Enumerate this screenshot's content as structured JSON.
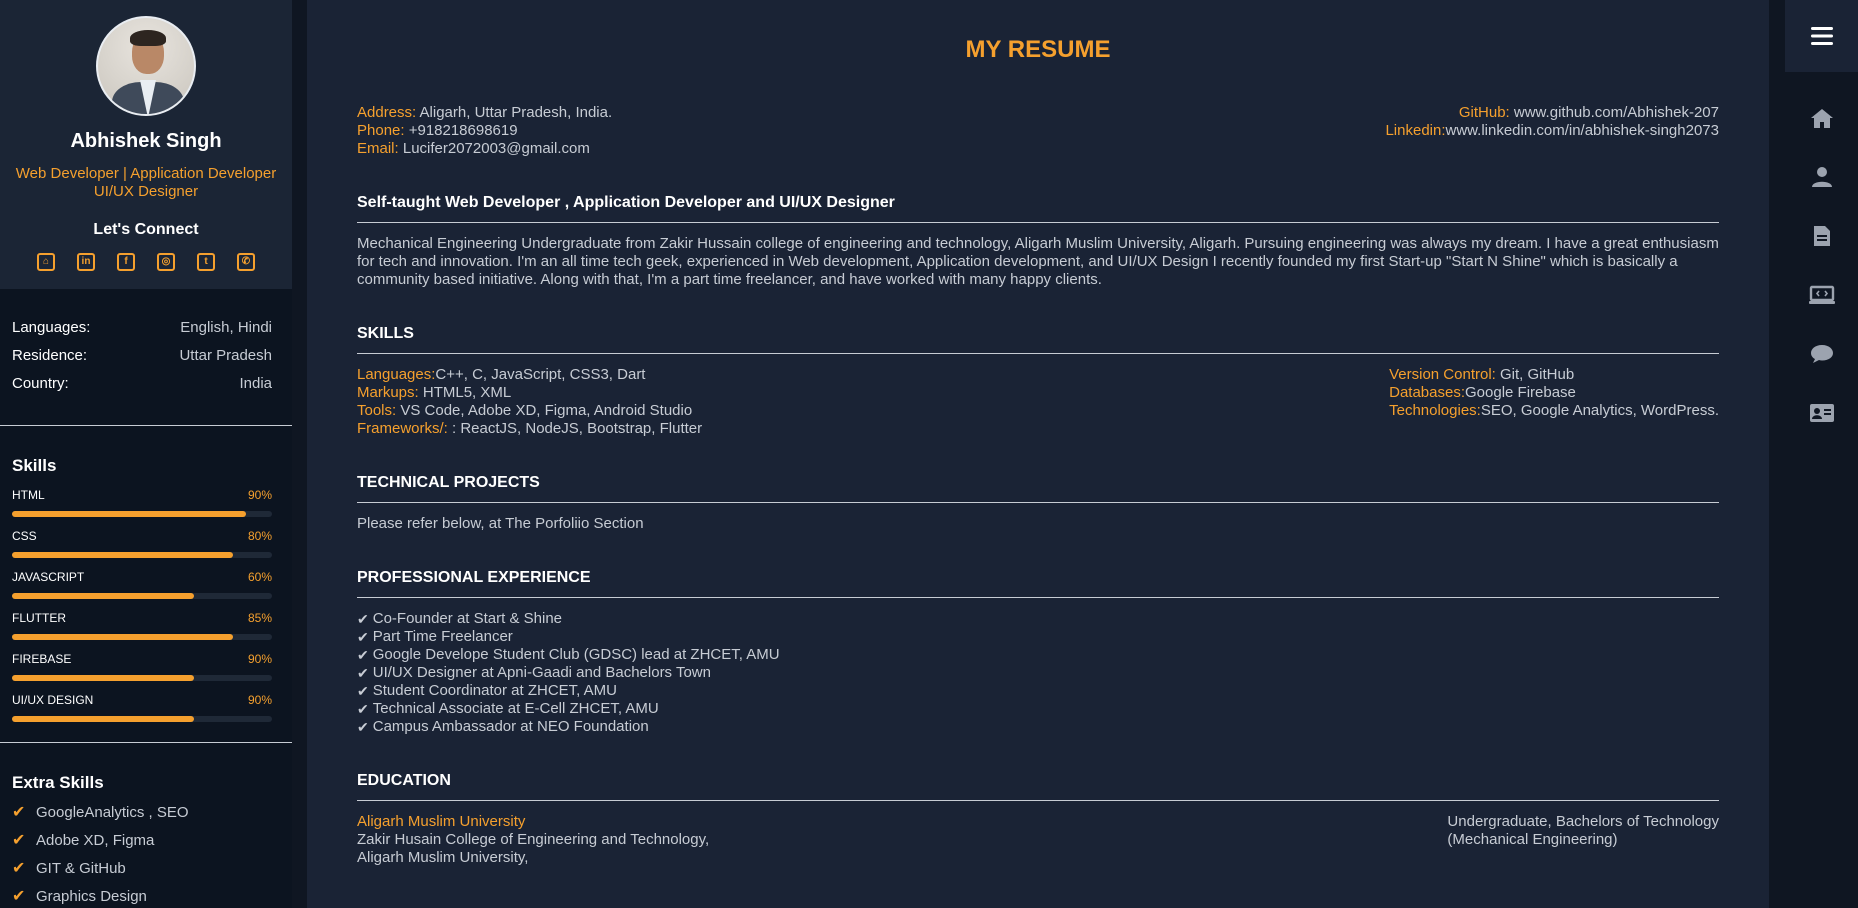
{
  "sidebar": {
    "name": "Abhishek Singh",
    "role_line1": "Web Developer | Application Developer",
    "role_line2": "UI/UX Designer",
    "connect_label": "Let's Connect",
    "socials": [
      "github-icon",
      "linkedin-icon",
      "facebook-icon",
      "instagram-icon",
      "twitter-icon",
      "whatsapp-icon"
    ],
    "info": [
      {
        "key": "Languages:",
        "value": "English, Hindi"
      },
      {
        "key": "Residence:",
        "value": "Uttar Pradesh"
      },
      {
        "key": "Country:",
        "value": "India"
      }
    ],
    "skills_heading": "Skills",
    "skills": [
      {
        "name": "HTML",
        "pct": "90%",
        "level": 0.9
      },
      {
        "name": "CSS",
        "pct": "80%",
        "level": 0.85
      },
      {
        "name": "JAVASCRIPT",
        "pct": "60%",
        "level": 0.7
      },
      {
        "name": "FLUTTER",
        "pct": "85%",
        "level": 0.85
      },
      {
        "name": "FIREBASE",
        "pct": "90%",
        "level": 0.7
      },
      {
        "name": "UI/UX DESIGN",
        "pct": "90%",
        "level": 0.7
      }
    ],
    "extra_heading": "Extra Skills",
    "extra": [
      "GoogleAnalytics , SEO",
      "Adobe XD, Figma",
      "GIT & GitHub",
      "Graphics Design"
    ]
  },
  "main": {
    "title": "MY RESUME",
    "contact_left": [
      {
        "label": "Address:",
        "value": " Aligarh, Uttar Pradesh, India."
      },
      {
        "label": "Phone:",
        "value": " +918218698619"
      },
      {
        "label": "Email:",
        "value": " Lucifer2072003@gmail.com"
      }
    ],
    "contact_right": [
      {
        "label": "GitHub:",
        "value": " www.github.com/Abhishek-207"
      },
      {
        "label": "Linkedin:",
        "value": "www.linkedin.com/in/abhishek-singh2073"
      }
    ],
    "about_heading": "Self-taught Web Developer , Application Developer and UI/UX Designer",
    "about_text": "Mechanical Engineering Undergraduate from Zakir Hussain college of engineering and technology, Aligarh Muslim University, Aligarh. Pursuing engineering was always my dream. I have a great enthusiasm for tech and innovation. I'm an all time tech geek, experienced in Web development, Application development, and UI/UX Design I recently founded my first Start-up \"Start N Shine\" which is basically a community based initiative. Along with that, I'm a part time freelancer, and have worked with many happy clients.",
    "skills_heading": "SKILLS",
    "skills_left": [
      {
        "label": "Languages:",
        "value": "C++, C, JavaScript, CSS3, Dart"
      },
      {
        "label": "Markups:",
        "value": " HTML5, XML"
      },
      {
        "label": "Tools:",
        "value": " VS Code, Adobe XD, Figma, Android Studio"
      },
      {
        "label": "Frameworks/:",
        "value": " : ReactJS, NodeJS, Bootstrap, Flutter"
      }
    ],
    "skills_right": [
      {
        "label": "Version Control:",
        "value": " Git, GitHub"
      },
      {
        "label": "Databases:",
        "value": "Google Firebase"
      },
      {
        "label": "Technologies:",
        "value": "SEO, Google Analytics, WordPress."
      }
    ],
    "projects_heading": "TECHNICAL PROJECTS",
    "projects_text": "Please refer below, at The Porfoliio Section",
    "experience_heading": "PROFESSIONAL EXPERIENCE",
    "experience": [
      "Co-Founder at Start & Shine",
      "Part Time Freelancer",
      "Google Develope Student Club (GDSC) lead at ZHCET, AMU",
      "UI/UX Designer at Apni-Gaadi and Bachelors Town",
      "Student Coordinator at ZHCET, AMU",
      "Technical Associate at E-Cell ZHCET, AMU",
      "Campus Ambassador at NEO Foundation"
    ],
    "education_heading": "EDUCATION",
    "edu_school": "Aligarh Muslim University",
    "edu_line2": "Zakir Husain College of Engineering and Technology,",
    "edu_line3": "Aligarh Muslim University,",
    "edu_degree1": "Undergraduate, Bachelors of Technology",
    "edu_degree2": "(Mechanical Engineering)"
  },
  "rail": {
    "icons": [
      "home-icon",
      "user-icon",
      "document-icon",
      "portfolio-icon",
      "chat-icon",
      "contact-card-icon"
    ]
  },
  "colors": {
    "accent": "#f5a02e",
    "panel": "#1a2335",
    "sidebar": "#0c1420"
  }
}
